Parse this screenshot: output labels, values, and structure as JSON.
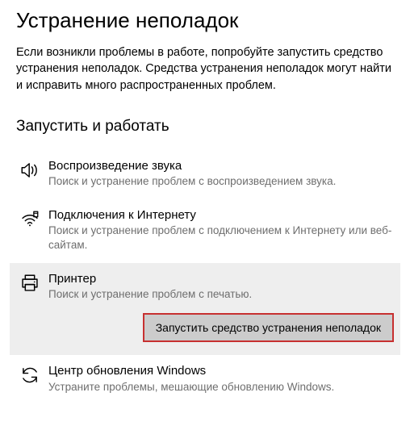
{
  "page": {
    "title": "Устранение неполадок",
    "intro": "Если возникли проблемы в работе, попробуйте запустить средство устранения неполадок. Средства устранения неполадок могут найти и исправить много распространенных проблем."
  },
  "section": {
    "title": "Запустить и работать"
  },
  "items": [
    {
      "title": "Воспроизведение звука",
      "desc": "Поиск и устранение проблем с воспроизведением звука."
    },
    {
      "title": "Подключения к Интернету",
      "desc": "Поиск и устранение проблем с подключением к Интернету или веб-сайтам."
    },
    {
      "title": "Принтер",
      "desc": "Поиск и устранение проблем с печатью."
    },
    {
      "title": "Центр обновления Windows",
      "desc": "Устраните проблемы, мешающие обновлению Windows."
    }
  ],
  "actions": {
    "run_troubleshooter": "Запустить средство устранения неполадок"
  }
}
